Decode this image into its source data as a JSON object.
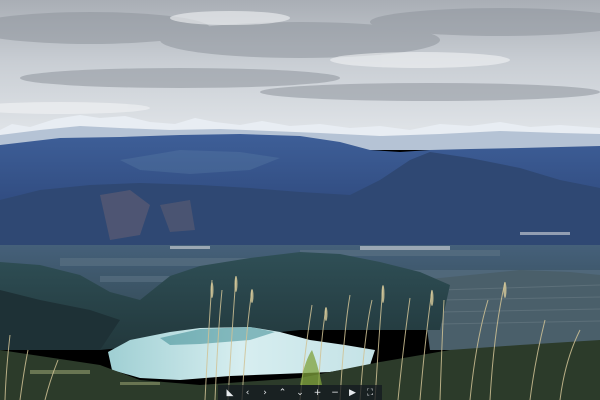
{
  "viewer": {
    "caption": "",
    "toolbar": {
      "buttons": [
        {
          "name": "fullscreen-shrink-icon",
          "glyph": "◣"
        },
        {
          "name": "arrow-left-icon",
          "glyph": "‹"
        },
        {
          "name": "arrow-right-icon",
          "glyph": "›"
        },
        {
          "name": "arrow-up-icon",
          "glyph": "⌃"
        },
        {
          "name": "arrow-down-icon",
          "glyph": "⌄"
        },
        {
          "name": "zoom-in-icon",
          "glyph": "+"
        },
        {
          "name": "zoom-out-icon",
          "glyph": "−"
        },
        {
          "name": "autoplay-icon",
          "glyph": "▶"
        },
        {
          "name": "fullscreen-icon",
          "glyph": "⛶"
        }
      ]
    }
  },
  "colors": {
    "sky_top": "#b8bcc2",
    "sky_bottom": "#dfe3e8",
    "snow": "#eef2f6",
    "far_ridge": "#3b5a93",
    "mid_ridge": "#324c7e",
    "valley": "#4a6076",
    "near_hill": "#2b4750",
    "lake": "#b6d9de",
    "grass": "#c8b88a"
  }
}
